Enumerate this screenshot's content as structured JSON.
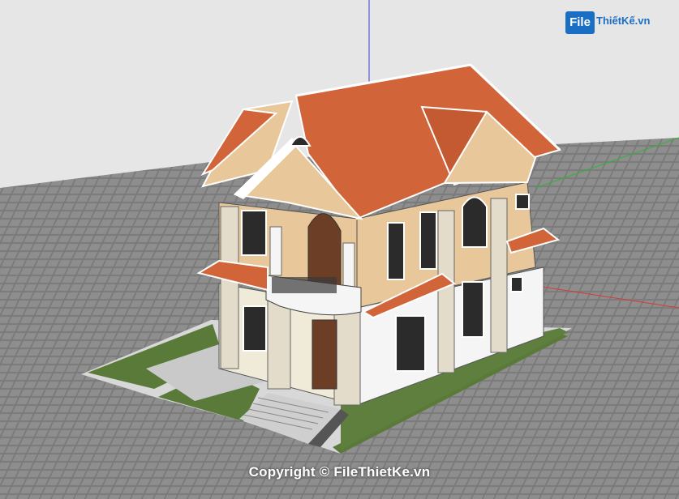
{
  "watermark_logo": {
    "box_text": "File",
    "text": "ThiếtKế.vn"
  },
  "copyright": "Copyright © FileThietKe.vn",
  "scene": {
    "description_icons": [
      "house-model"
    ],
    "colors": {
      "sky": "#e6e6e6",
      "ground": "#7d7d7d",
      "roof": "#d2643a",
      "wall_upper": "#e8c89a",
      "wall_lower": "#f5f5f5",
      "stone": "#e3dccb",
      "lawn": "#5a7a3a",
      "window": "#2b2b2b",
      "blue_axis": "#3b3bd8",
      "green_axis": "#2fb52f",
      "red_axis": "#d63a3a"
    }
  }
}
